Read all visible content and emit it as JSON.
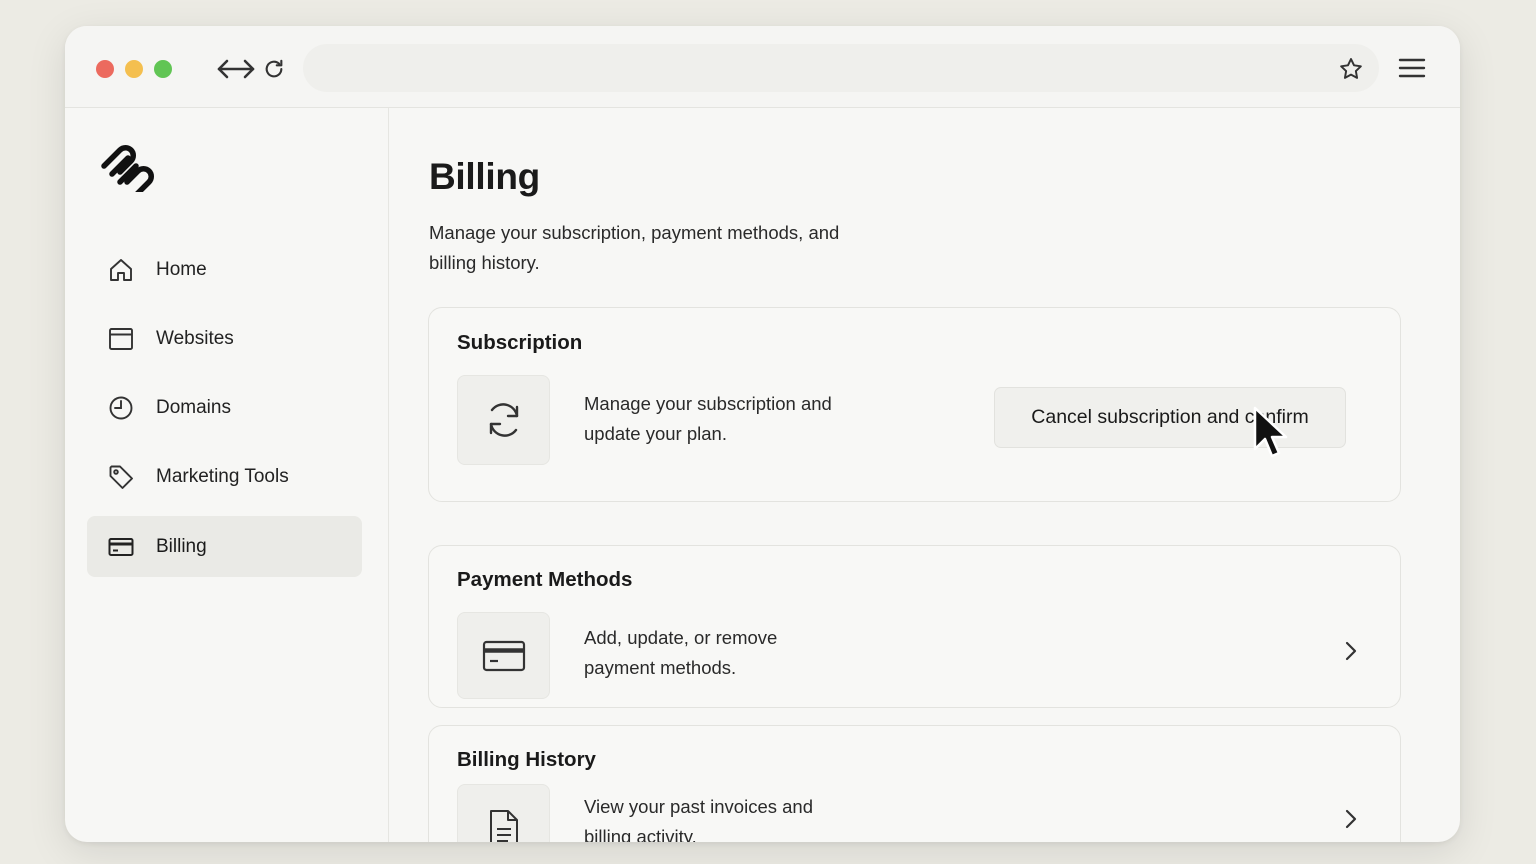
{
  "browser": {
    "url": "",
    "icons": [
      "back-forward-arrows-icon",
      "reload-icon",
      "star-icon",
      "hamburger-menu-icon"
    ]
  },
  "sidebar": {
    "items": [
      {
        "label": "Home",
        "icon": "home-icon",
        "active": false
      },
      {
        "label": "Websites",
        "icon": "browser-window-icon",
        "active": false
      },
      {
        "label": "Domains",
        "icon": "clock-icon",
        "active": false
      },
      {
        "label": "Marketing Tools",
        "icon": "tag-icon",
        "active": false
      },
      {
        "label": "Billing",
        "icon": "credit-card-icon",
        "active": true
      }
    ]
  },
  "main": {
    "title": "Billing",
    "description": "Manage your subscription, payment methods, and billing history.",
    "cards": {
      "subscription": {
        "title": "Subscription",
        "description": "Manage your subscription and update your plan.",
        "button_label": "Cancel subscription and confirm",
        "icon": "refresh-icon"
      },
      "payment_methods": {
        "title": "Payment Methods",
        "description": "Add, update, or remove payment methods.",
        "icon": "credit-card-icon"
      },
      "billing_history": {
        "title": "Billing History",
        "description": "View your past invoices and billing activity.",
        "icon": "document-icon"
      }
    }
  },
  "colors": {
    "background": "#ecebe4",
    "window": "#f7f7f5",
    "traffic_red": "#ec6a5e",
    "traffic_yellow": "#f4bf4f",
    "traffic_green": "#61c554",
    "active_nav": "#eaeae6"
  }
}
